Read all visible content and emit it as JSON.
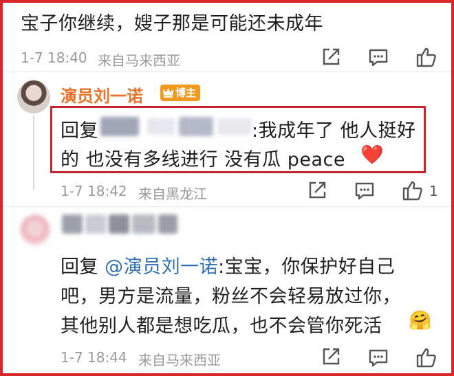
{
  "comment1": {
    "text": "宝子你继续，嫂子那是可能还未成年",
    "time": "1-7 18:40",
    "location": "来自马来西亚"
  },
  "reply1": {
    "author": "演员刘一诺",
    "badge": "博主",
    "prefix": "回复",
    "line1": ":我成年了 他人挺好",
    "line2": "的 也没有多线进行 没有瓜 peace",
    "heart": "❤️",
    "time": "1-7 18:42",
    "location": "来自黑龙江",
    "likes": "1"
  },
  "reply2": {
    "prefix": "回复 ",
    "mention": "@演员刘一诺",
    "line1_rest": ":宝宝，你保护好自己",
    "line2": "吧，男方是流量，粉丝不会轻易放过你，",
    "line3": "其他别人都是想吃瓜，也不会管你死活",
    "emoji": "🤗",
    "time": "1-7 18:44",
    "location": "来自马来西亚"
  },
  "icons": [
    "share-icon",
    "comment-icon",
    "like-icon",
    "crown-icon"
  ],
  "colors": {
    "frame": "#d8262a",
    "name": "#e8742b",
    "mention": "#2f6fb3",
    "badge": "#f39a1e"
  }
}
